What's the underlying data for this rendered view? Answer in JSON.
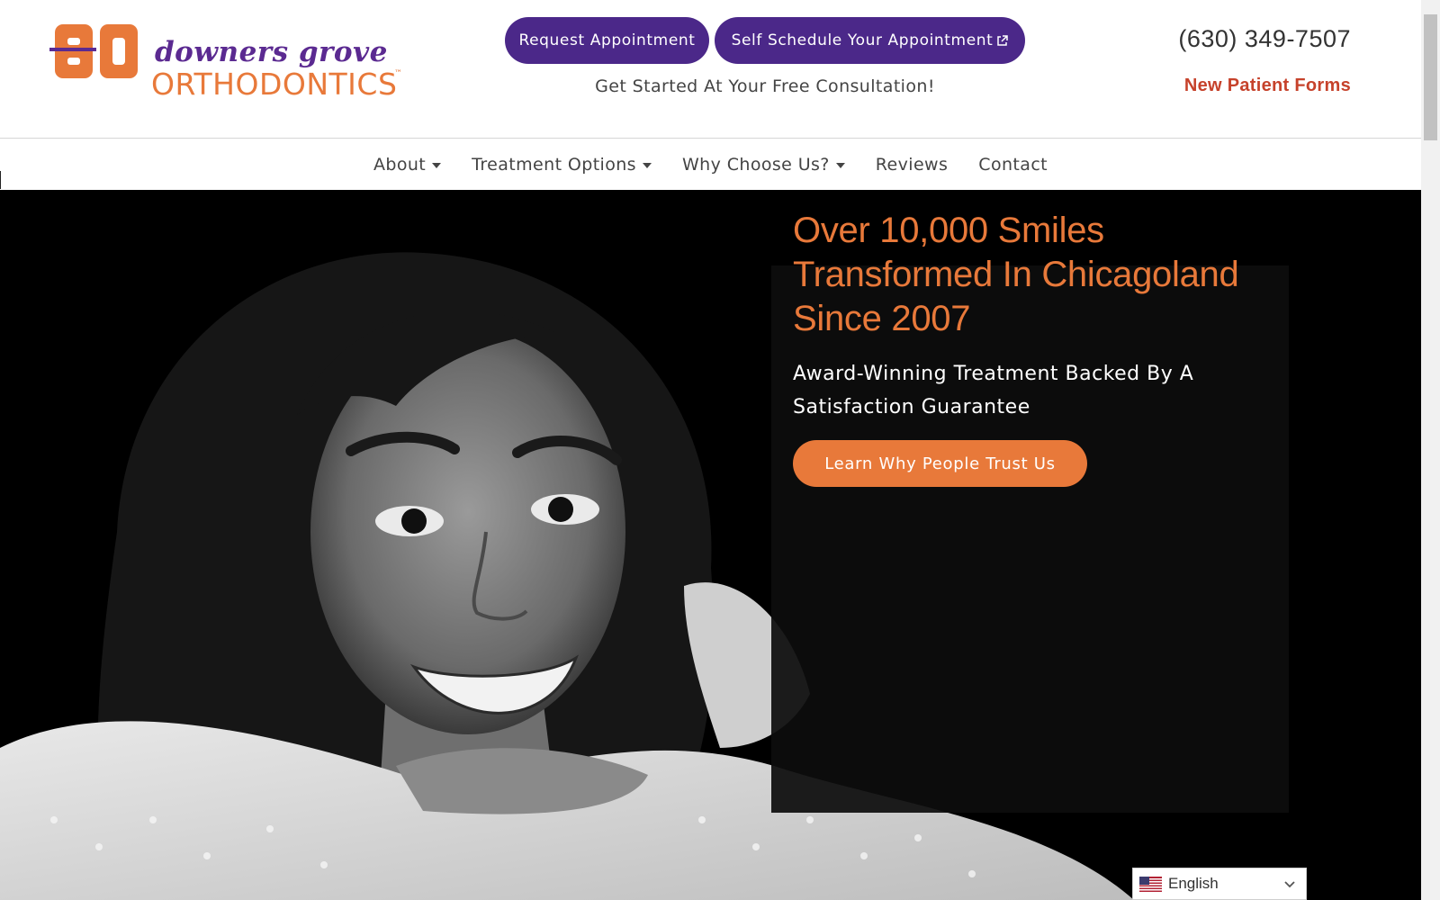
{
  "header": {
    "logo": {
      "line1": "downers grove",
      "line2": "ORTHODONTICS",
      "tm": "™"
    },
    "buttons": {
      "request": "Request Appointment",
      "self_schedule": "Self Schedule Your Appointment"
    },
    "subline": "Get Started At Your Free Consultation!",
    "phone": "(630) 349-7507",
    "forms_link": "New Patient Forms"
  },
  "nav": {
    "items": [
      {
        "label": "About",
        "dropdown": true
      },
      {
        "label": "Treatment Options",
        "dropdown": true
      },
      {
        "label": "Why Choose Us?",
        "dropdown": true
      },
      {
        "label": "Reviews",
        "dropdown": false
      },
      {
        "label": "Contact",
        "dropdown": false
      }
    ]
  },
  "hero": {
    "title": "Over 10,000 Smiles Transformed In Chicagoland Since 2007",
    "subtitle": "Award-Winning Treatment Backed By A Satisfaction Guarantee",
    "cta": "Learn Why People Trust Us"
  },
  "language": {
    "selected": "English",
    "flag_icon": "us-flag-icon"
  },
  "colors": {
    "purple": "#4b2889",
    "orange": "#e8793a",
    "red_link": "#c6422b"
  }
}
